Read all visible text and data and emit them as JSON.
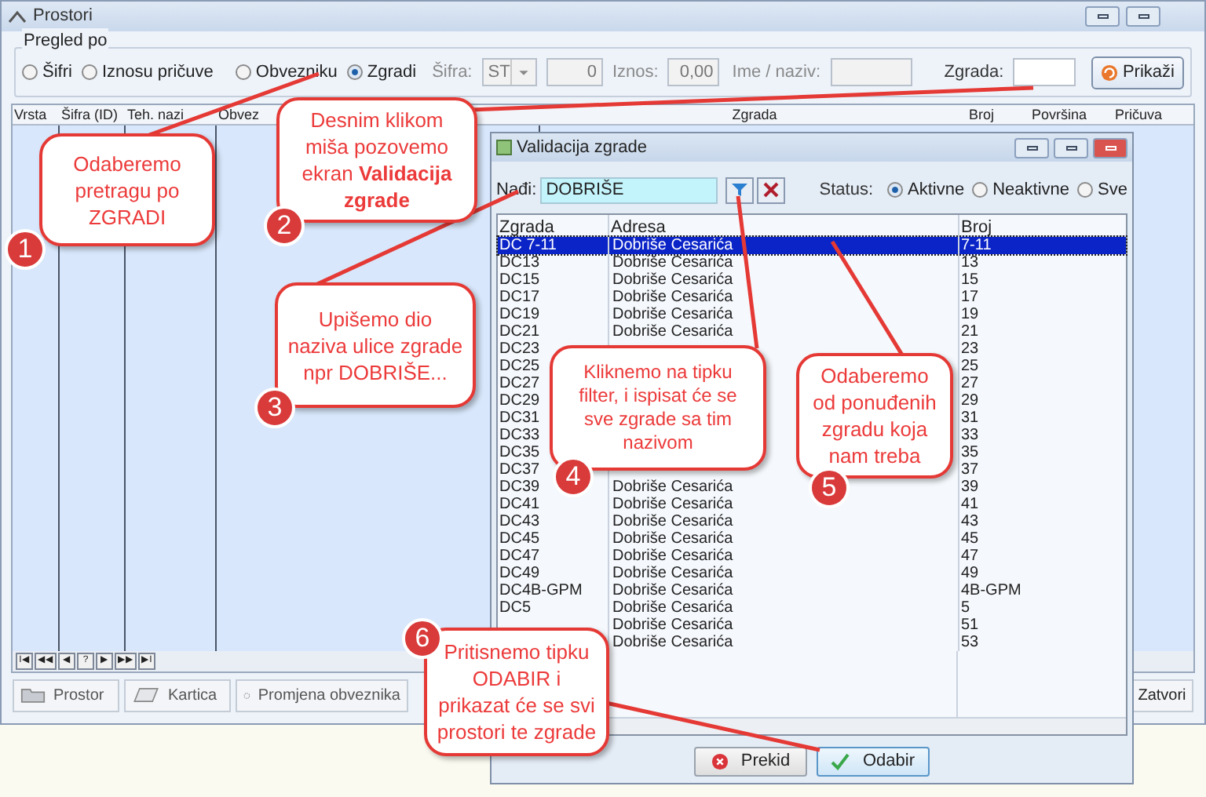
{
  "window": {
    "title": "Prostori"
  },
  "filter": {
    "legend": "Pregled po",
    "radios": [
      {
        "label": "Šifri",
        "selected": false
      },
      {
        "label": "Iznosu pričuve",
        "selected": false
      },
      {
        "label": "Obvezniku",
        "selected": false
      },
      {
        "label": "Zgradi",
        "selected": true
      }
    ],
    "sifra_label": "Šifra:",
    "sifra_value": "ST",
    "sifra_number": "0",
    "iznos_label": "Iznos:",
    "iznos_value": "0,00",
    "ime_label": "Ime / naziv:",
    "zgrada_label": "Zgrada:",
    "show_button": "Prikaži"
  },
  "table": {
    "columns": [
      "Vrsta",
      "Šifra (ID)",
      "Teh. nazi",
      "Obvez",
      "Zgrada",
      "Broj",
      "Površina",
      "Pričuva"
    ]
  },
  "navigator": [
    "I◀",
    "◀◀",
    "◀",
    "?",
    "▶",
    "▶▶",
    "▶I"
  ],
  "bottom_buttons": [
    {
      "label": "Prostor",
      "kind": "folder"
    },
    {
      "label": "Kartica",
      "kind": "card"
    },
    {
      "label": "Promjena obveznika",
      "kind": "cycle"
    }
  ],
  "close_button": "Zatvori",
  "dialog": {
    "title": "Validacija zgrade",
    "search_label": "Nađi:",
    "search_value": "DOBRIŠE",
    "status_label": "Status:",
    "statuses": [
      {
        "label": "Aktivne",
        "selected": true
      },
      {
        "label": "Neaktivne",
        "selected": false
      },
      {
        "label": "Sve",
        "selected": false
      }
    ],
    "columns": [
      "Zgrada",
      "Adresa",
      "Broj"
    ],
    "rows": [
      {
        "zgrada": "DC 7-11",
        "adresa": "Dobriše Cesarića",
        "broj": "7-11",
        "selected": true
      },
      {
        "zgrada": "DC13",
        "adresa": "Dobriše Cesarića",
        "broj": "13",
        "selected": false
      },
      {
        "zgrada": "DC15",
        "adresa": "Dobriše Cesarića",
        "broj": "15",
        "selected": false
      },
      {
        "zgrada": "DC17",
        "adresa": "Dobriše Cesarića",
        "broj": "17",
        "selected": false
      },
      {
        "zgrada": "DC19",
        "adresa": "Dobriše Cesarića",
        "broj": "19",
        "selected": false
      },
      {
        "zgrada": "DC21",
        "adresa": "Dobriše Cesarića",
        "broj": "21",
        "selected": false
      },
      {
        "zgrada": "DC23",
        "broj": "23",
        "selected": false
      },
      {
        "zgrada": "DC25",
        "broj": "25",
        "selected": false
      },
      {
        "zgrada": "DC27",
        "broj": "27",
        "selected": false
      },
      {
        "zgrada": "DC29",
        "broj": "29",
        "selected": false
      },
      {
        "zgrada": "DC31",
        "broj": "31",
        "selected": false
      },
      {
        "zgrada": "DC33",
        "broj": "33",
        "selected": false
      },
      {
        "zgrada": "DC35",
        "broj": "35",
        "selected": false
      },
      {
        "zgrada": "DC37",
        "broj": "37",
        "selected": false
      },
      {
        "zgrada": "DC39",
        "adresa": "Dobriše Cesarića",
        "broj": "39",
        "selected": false
      },
      {
        "zgrada": "DC41",
        "adresa": "Dobriše Cesarića",
        "broj": "41",
        "selected": false
      },
      {
        "zgrada": "DC43",
        "adresa": "Dobriše Cesarića",
        "broj": "43",
        "selected": false
      },
      {
        "zgrada": "DC45",
        "adresa": "Dobriše Cesarića",
        "broj": "45",
        "selected": false
      },
      {
        "zgrada": "DC47",
        "adresa": "Dobriše Cesarića",
        "broj": "47",
        "selected": false
      },
      {
        "zgrada": "DC49",
        "adresa": "Dobriše Cesarića",
        "broj": "49",
        "selected": false
      },
      {
        "zgrada": "DC4B-GPM",
        "adresa": "Dobriše Cesarića",
        "broj": "4B-GPM",
        "selected": false
      },
      {
        "zgrada": "DC5",
        "adresa": "Dobriše Cesarića",
        "broj": "5",
        "selected": false
      },
      {
        "adresa": "Dobriše Cesarića",
        "broj": "51",
        "selected": false
      },
      {
        "adresa": "Dobriše Cesarića",
        "broj": "53",
        "selected": false
      }
    ],
    "cancel_button": "Prekid",
    "ok_button": "Odabir"
  },
  "callouts": [
    {
      "number": "1",
      "text": "Odaberemo pretragu po ZGRADI"
    },
    {
      "number": "2",
      "text": "Desnim klikom miša pozovemo ekran **Validacija zgrade**"
    },
    {
      "number": "3",
      "text": "Upišemo dio naziva ulice zgrade npr DOBRIŠE..."
    },
    {
      "number": "4",
      "text": "Kliknemo na tipku filter, i ispisat će se sve zgrade sa tim nazivom"
    },
    {
      "number": "5",
      "text": "Odaberemo od ponuđenih zgradu koja nam treba"
    },
    {
      "number": "6",
      "text": "Pritisnemo tipku ODABIR i prikazat će se svi prostori te zgrade"
    }
  ]
}
